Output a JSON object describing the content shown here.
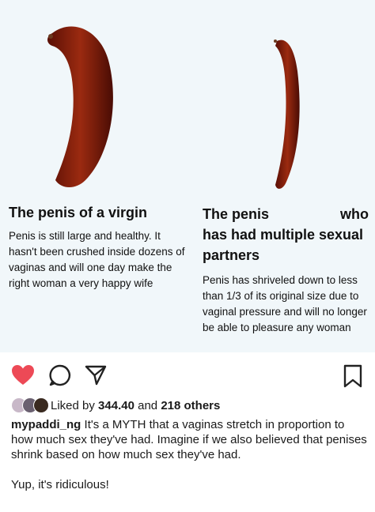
{
  "post_image": {
    "left": {
      "title": "The penis of a virgin",
      "body": "Penis is still large and healthy. It hasn't been crushed inside dozens of vaginas and will one day make the right woman a very happy wife"
    },
    "right": {
      "title_word1": "The penis",
      "title_word2": "who",
      "title_rest": "has had multiple sexual partners",
      "body": "Penis has shriveled down to less than 1/3 of its original size due to vaginal pressure and will no longer be able to pleasure any woman"
    }
  },
  "actions": {
    "like_icon": "heart-icon",
    "comment_icon": "comment-icon",
    "share_icon": "send-icon",
    "save_icon": "bookmark-icon",
    "like_color": "#ed4956"
  },
  "likes": {
    "prefix": "Liked by",
    "first_liker": "344.40",
    "connector": "and",
    "others": "218 others"
  },
  "caption": {
    "username": "mypaddi_ng",
    "text": "It's a MYTH that a vaginas stretch in proportion to how much sex they've had. Imagine if we also believed that penises shrink based on how much sex they've had.",
    "second_paragraph": "Yup, it's ridiculous!"
  }
}
